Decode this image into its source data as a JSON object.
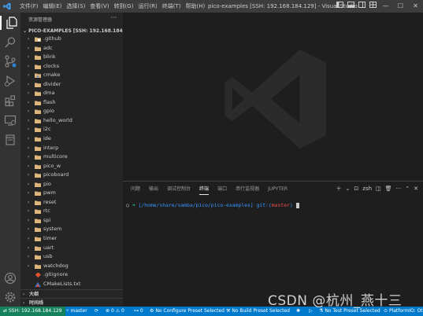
{
  "menu": [
    "文件(F)",
    "编辑(E)",
    "选择(S)",
    "查看(V)",
    "转到(G)",
    "运行(R)",
    "终端(T)",
    "帮助(H)"
  ],
  "window_title": "pico-examples [SSH: 192.168.184.129] - Visual Studio ...",
  "sidebar": {
    "title": "资源管理器",
    "root": "PICO-EXAMPLES [SSH: 192.168.184.129]",
    "items": [
      {
        "label": ".github",
        "type": "folder-github"
      },
      {
        "label": "adc",
        "type": "folder"
      },
      {
        "label": "blink",
        "type": "folder"
      },
      {
        "label": "clocks",
        "type": "folder"
      },
      {
        "label": "cmake",
        "type": "folder-cmake"
      },
      {
        "label": "divider",
        "type": "folder"
      },
      {
        "label": "dma",
        "type": "folder"
      },
      {
        "label": "flash",
        "type": "folder"
      },
      {
        "label": "gpio",
        "type": "folder"
      },
      {
        "label": "hello_world",
        "type": "folder"
      },
      {
        "label": "i2c",
        "type": "folder"
      },
      {
        "label": "ide",
        "type": "folder"
      },
      {
        "label": "interp",
        "type": "folder"
      },
      {
        "label": "multicore",
        "type": "folder"
      },
      {
        "label": "pico_w",
        "type": "folder"
      },
      {
        "label": "picoboard",
        "type": "folder"
      },
      {
        "label": "pio",
        "type": "folder"
      },
      {
        "label": "pwm",
        "type": "folder"
      },
      {
        "label": "reset",
        "type": "folder"
      },
      {
        "label": "rtc",
        "type": "folder"
      },
      {
        "label": "spi",
        "type": "folder"
      },
      {
        "label": "system",
        "type": "folder"
      },
      {
        "label": "timer",
        "type": "folder"
      },
      {
        "label": "uart",
        "type": "folder"
      },
      {
        "label": "usb",
        "type": "folder"
      },
      {
        "label": "watchdog",
        "type": "folder"
      },
      {
        "label": ".gitignore",
        "type": "git-file"
      },
      {
        "label": "CMakeLists.txt",
        "type": "cmake-file"
      }
    ],
    "outline": "大纲",
    "timeline": "时间线"
  },
  "panel": {
    "tabs": [
      "问题",
      "输出",
      "调试控制台",
      "终端",
      "端口",
      "串行监视器",
      "JUPYTER"
    ],
    "active_tab": "终端",
    "shell": "zsh",
    "terminal": {
      "prompt_symbol": "➜",
      "path": "[/home/share/samba/pico/pico-examples]",
      "git_prefix": "git:(",
      "branch": "master",
      "git_suffix": ")"
    }
  },
  "statusbar": {
    "remote": "SSH: 192.168.184.129",
    "branch": "master",
    "errors": "0",
    "warnings": "0",
    "ports": "0",
    "configure": "No Configure Preset Selected",
    "build": "No Build Preset Selected",
    "test": "No Test Preset Selected",
    "platformio": "PlatformIO: Ot"
  },
  "watermark": "CSDN @杭州_燕十三",
  "colors": {
    "accent": "#007acc",
    "remote": "#16825d",
    "folder": "#dcb67a",
    "terminal_path": "#3794ff",
    "branch": "#f14c4c",
    "prompt": "#23d18b"
  }
}
